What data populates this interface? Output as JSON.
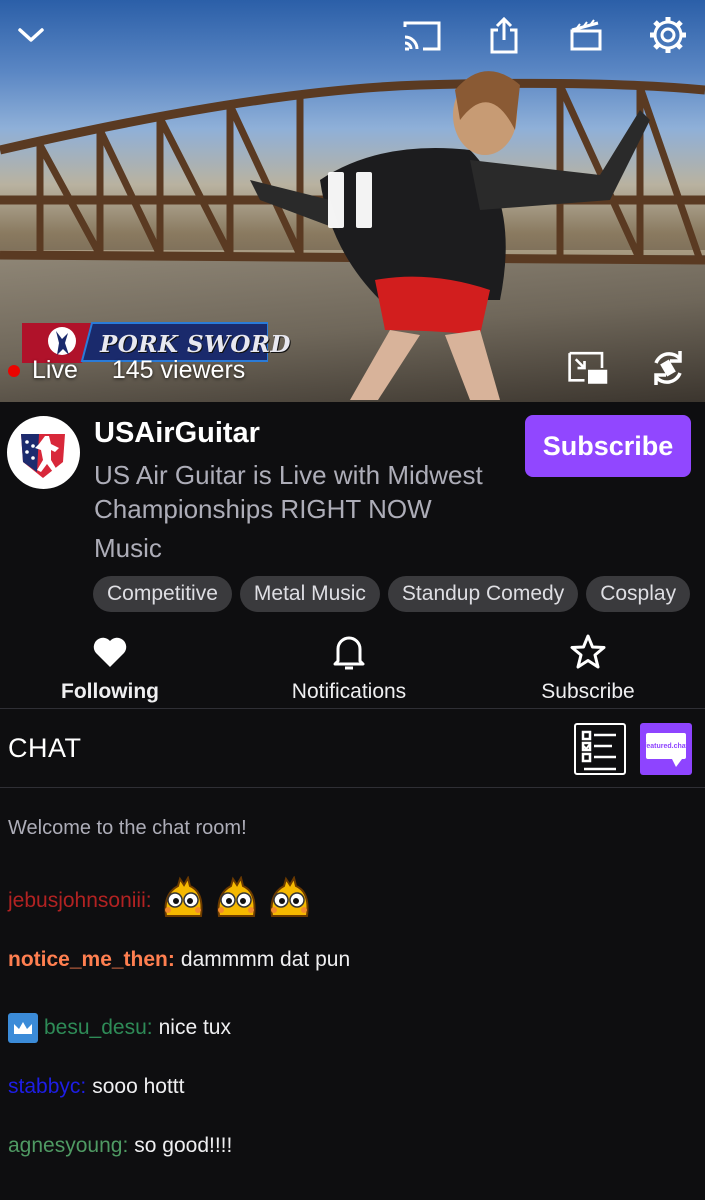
{
  "player": {
    "icons": [
      "chevron-down-icon",
      "cast-icon",
      "share-icon",
      "clapperboard-icon",
      "gear-icon",
      "pause-icon",
      "picture-in-picture-icon",
      "rotate-icon"
    ],
    "live_label": "Live",
    "viewers": "145 viewers",
    "sponsor_text": "PORK SWORD"
  },
  "channel": {
    "name": "USAirGuitar",
    "title": "US Air Guitar is Live with Midwest Championships RIGHT NOW",
    "category": "Music",
    "subscribe_label": "Subscribe",
    "tags": [
      "Competitive",
      "Metal Music",
      "Standup Comedy",
      "Cosplay"
    ]
  },
  "actions": {
    "following": "Following",
    "notifications": "Notifications",
    "subscribe": "Subscribe"
  },
  "chat": {
    "title": "CHAT",
    "featured_label": "featured.chat",
    "welcome": "Welcome to the chat room!",
    "messages": [
      {
        "user": "jebusjohnsoniii",
        "text": "",
        "color": "#b22222"
      },
      {
        "user": "notice_me_then",
        "text": "dammmm dat pun",
        "color": "#ff7f50"
      },
      {
        "user": "besu_desu",
        "text": "nice tux",
        "color": "#2e8b57"
      },
      {
        "user": "stabbyc",
        "text": "sooo hottt",
        "color": "#1e1ee6"
      },
      {
        "user": "agnesyoung",
        "text": "so good!!!!",
        "color": "#4f9a63"
      }
    ]
  },
  "colors": {
    "accent": "#9147ff",
    "background": "#0e0e10",
    "live": "#eb0400"
  }
}
